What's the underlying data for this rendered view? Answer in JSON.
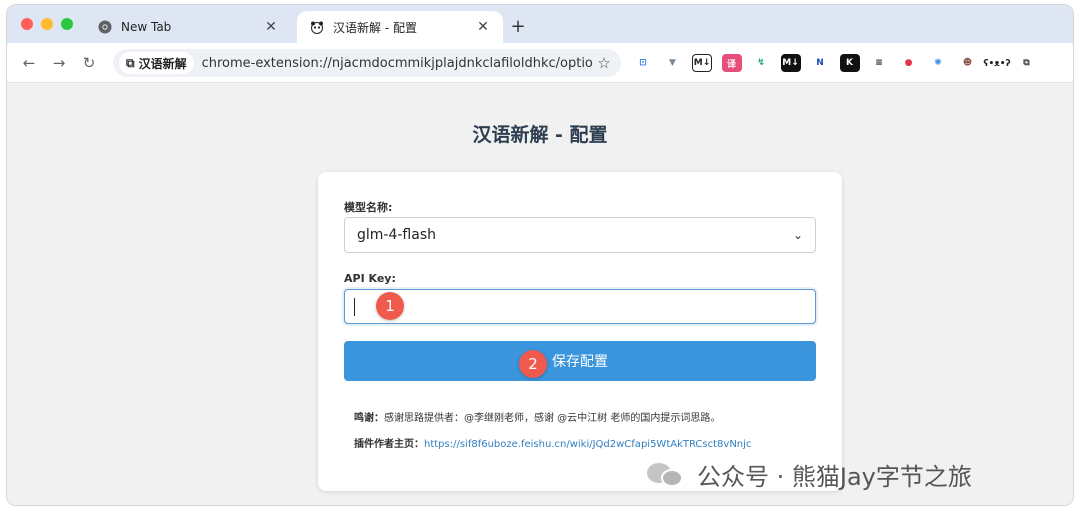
{
  "tabs": [
    {
      "title": "New Tab",
      "icon": "chrome-icon"
    },
    {
      "title": "汉语新解 - 配置",
      "icon": "panda-icon"
    }
  ],
  "toolbar": {
    "extension_chip": "汉语新解",
    "url": "chrome-extension://njacmdocmmikjplajdnkclafiloldhkc/options.html"
  },
  "extension_icons": [
    {
      "name": "crop-icon",
      "glyph": "⊡",
      "bg": "",
      "color": "#2d7be5"
    },
    {
      "name": "vuejs-icon",
      "glyph": "▼",
      "bg": "",
      "color": "#7a8a99"
    },
    {
      "name": "markdown-icon",
      "glyph": "M↓",
      "bg": "#ffffff",
      "color": "#222222"
    },
    {
      "name": "translate-icon",
      "glyph": "译",
      "bg": "#e84e7a",
      "color": "#ffffff"
    },
    {
      "name": "leaf-icon",
      "glyph": "↯",
      "bg": "",
      "color": "#1aa06d"
    },
    {
      "name": "mh-icon",
      "glyph": "M↓",
      "bg": "#111111",
      "color": "#ffffff"
    },
    {
      "name": "n-icon",
      "glyph": "N",
      "bg": "",
      "color": "#1e4bb8"
    },
    {
      "name": "k-icon",
      "glyph": "K",
      "bg": "#111111",
      "color": "#ffffff"
    },
    {
      "name": "list-icon",
      "glyph": "≡",
      "bg": "",
      "color": "#222222"
    },
    {
      "name": "red-circle-icon",
      "glyph": "●",
      "bg": "",
      "color": "#e8344a"
    },
    {
      "name": "settings-gear-icon",
      "glyph": "✺",
      "bg": "",
      "color": "#3a8ee6"
    },
    {
      "name": "avatar-icon",
      "glyph": "☻",
      "bg": "",
      "color": "#8a5a4a"
    },
    {
      "name": "panda-ext-icon",
      "glyph": "ʕ•ᴥ•ʔ",
      "bg": "",
      "color": "#222222"
    },
    {
      "name": "puzzle-icon",
      "glyph": "⧉",
      "bg": "",
      "color": "#444444"
    }
  ],
  "page": {
    "title": "汉语新解 - 配置"
  },
  "form": {
    "model_label": "模型名称:",
    "model_value": "glm-4-flash",
    "api_key_label": "API Key:",
    "api_key_value": "",
    "save_label": "保存配置"
  },
  "markers": {
    "m1": "1",
    "m2": "2"
  },
  "notes": {
    "thanks_label": "鸣谢：",
    "thanks_text": "感谢思路提供者：@李继刚老师，感谢 @云中江树 老师的国内提示词思路。",
    "author_label": "插件作者主页：",
    "author_link": "https://sif8f6uboze.feishu.cn/wiki/JQd2wCfapi5WtAkTRCsct8vNnjc"
  },
  "watermark": {
    "text": "公众号 · 熊猫Jay字节之旅"
  }
}
